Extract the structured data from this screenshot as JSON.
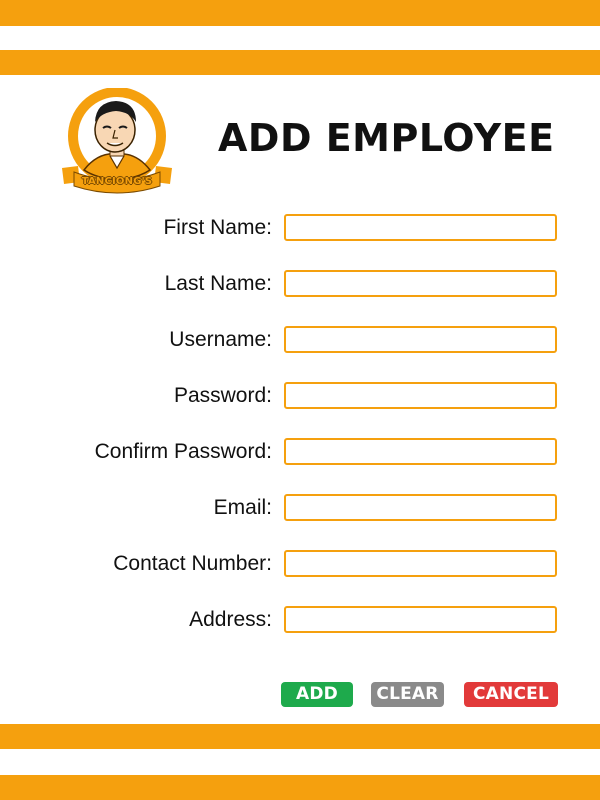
{
  "title": "ADD EMPLOYEE",
  "logo": {
    "text": "TANCIONG'S",
    "icon": "caricature-logo"
  },
  "fields": [
    {
      "label": "First Name:",
      "value": "",
      "placeholder": ""
    },
    {
      "label": "Last Name:",
      "value": "",
      "placeholder": ""
    },
    {
      "label": "Username:",
      "value": "",
      "placeholder": ""
    },
    {
      "label": "Password:",
      "value": "",
      "placeholder": ""
    },
    {
      "label": "Confirm Password:",
      "value": "",
      "placeholder": ""
    },
    {
      "label": "Email:",
      "value": "",
      "placeholder": ""
    },
    {
      "label": "Contact Number:",
      "value": "",
      "placeholder": ""
    },
    {
      "label": "Address:",
      "value": "",
      "placeholder": ""
    }
  ],
  "buttons": {
    "add": "ADD",
    "clear": "CLEAR",
    "cancel": "CANCEL"
  },
  "colors": {
    "accent": "#f5a00e",
    "add": "#1eaa4c",
    "clear": "#8a8a8a",
    "cancel": "#e23a3a"
  }
}
